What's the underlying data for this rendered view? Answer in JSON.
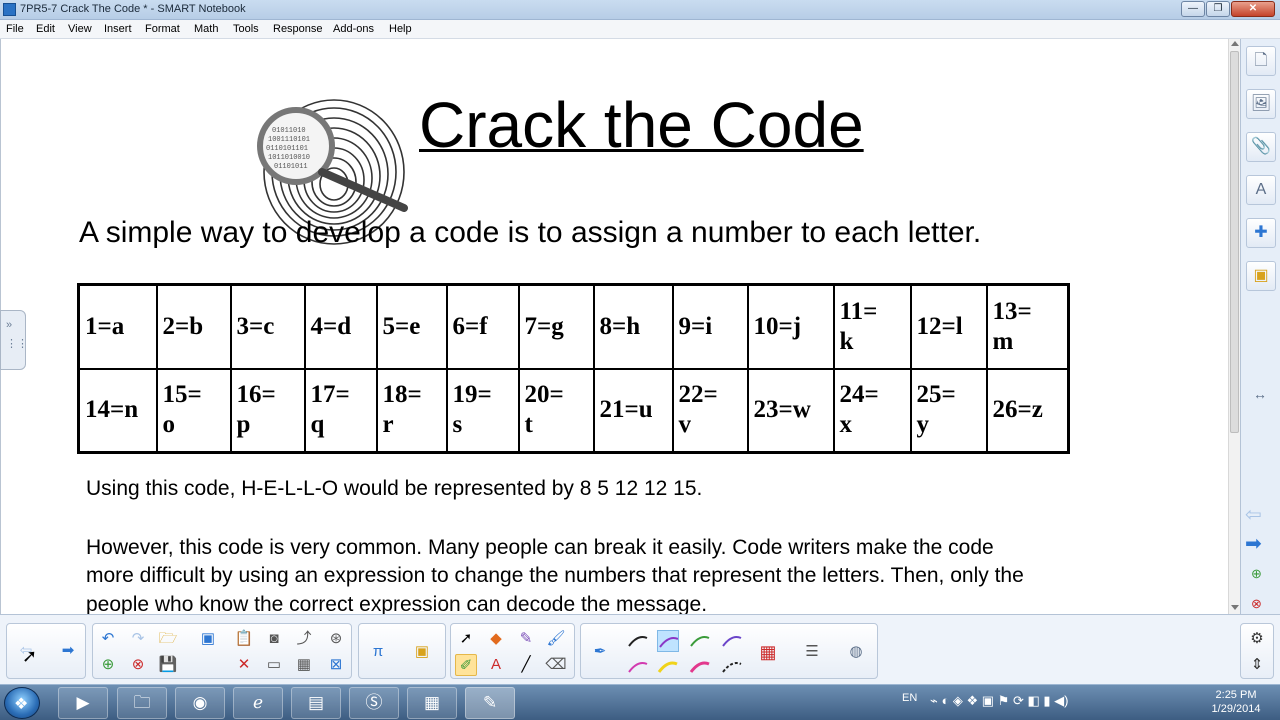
{
  "window": {
    "title": "7PR5-7 Crack The Code * - SMART Notebook",
    "min": "—",
    "max": "❐",
    "close": "✕"
  },
  "menu": [
    "File",
    "Edit",
    "View",
    "Insert",
    "Format",
    "Math",
    "Tools",
    "Response",
    "Add-ons",
    "Help"
  ],
  "page": {
    "title": "Crack the Code",
    "subtitle": "A simple way to develop a code is to assign a number to each letter.",
    "table": [
      [
        "1=a",
        "2=b",
        "3=c",
        "4=d",
        "5=e",
        "6=f",
        "7=g",
        "8=h",
        "9=i",
        "10=j",
        "11=\nk",
        "12=l",
        "13=\nm"
      ],
      [
        "14=n",
        "15=\no",
        "16=\np",
        "17=\nq",
        "18=\nr",
        "19=\ns",
        "20=\nt",
        "21=u",
        "22=\nv",
        "23=w",
        "24=\nx",
        "25=\ny",
        "26=z"
      ]
    ],
    "paragraph1": "Using this code, H-E-L-L-O would be represented by 8  5  12  12  15.",
    "paragraph2_lines": [
      "However, this code is very common.  Many people can break it easily.  Code writers make the code",
      "more difficult by using an expression to change the numbers that represent the letters.  Then, only the",
      "people who know the correct expression can decode the message."
    ]
  },
  "sidebar_tabs": [
    "page-sorter-icon",
    "gallery-icon",
    "attachments-icon",
    "properties-icon",
    "add-ons-icon",
    "response-icon"
  ],
  "taskbar": {
    "language": "EN",
    "time": "2:25 PM",
    "date": "1/29/2014"
  },
  "colors": {
    "accent": "#2d76d2",
    "toolbar_bg": "#eef3fa",
    "taskbar": "#3d5d82"
  }
}
